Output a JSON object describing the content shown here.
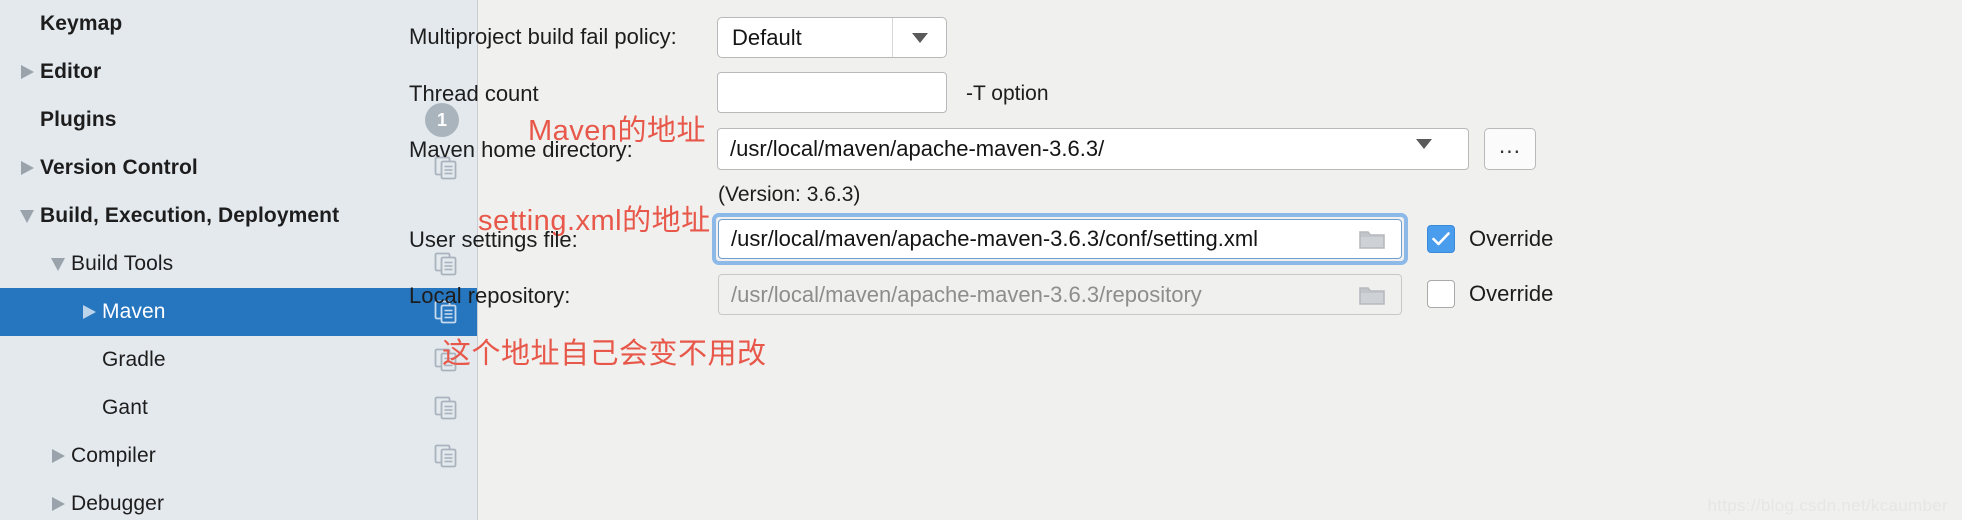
{
  "sidebar": {
    "items": [
      {
        "label": "Keymap",
        "indent": 0,
        "twisty": "none",
        "bold": true,
        "selected": false,
        "badge": null,
        "copy_icon": false
      },
      {
        "label": "Editor",
        "indent": 0,
        "twisty": "collapsed",
        "bold": true,
        "selected": false,
        "badge": null,
        "copy_icon": false
      },
      {
        "label": "Plugins",
        "indent": 0,
        "twisty": "none",
        "bold": true,
        "selected": false,
        "badge": "1",
        "copy_icon": false
      },
      {
        "label": "Version Control",
        "indent": 0,
        "twisty": "collapsed",
        "bold": true,
        "selected": false,
        "badge": null,
        "copy_icon": true
      },
      {
        "label": "Build, Execution, Deployment",
        "indent": 0,
        "twisty": "expanded",
        "bold": true,
        "selected": false,
        "badge": null,
        "copy_icon": false
      },
      {
        "label": "Build Tools",
        "indent": 1,
        "twisty": "expanded",
        "bold": false,
        "selected": false,
        "badge": null,
        "copy_icon": true
      },
      {
        "label": "Maven",
        "indent": 2,
        "twisty": "collapsed",
        "bold": false,
        "selected": true,
        "badge": null,
        "copy_icon": true
      },
      {
        "label": "Gradle",
        "indent": 2,
        "twisty": "none",
        "bold": false,
        "selected": false,
        "badge": null,
        "copy_icon": true
      },
      {
        "label": "Gant",
        "indent": 2,
        "twisty": "none",
        "bold": false,
        "selected": false,
        "badge": null,
        "copy_icon": true
      },
      {
        "label": "Compiler",
        "indent": 1,
        "twisty": "collapsed",
        "bold": false,
        "selected": false,
        "badge": null,
        "copy_icon": true
      },
      {
        "label": "Debugger",
        "indent": 1,
        "twisty": "collapsed",
        "bold": false,
        "selected": false,
        "badge": null,
        "copy_icon": false
      }
    ]
  },
  "main": {
    "fail_policy": {
      "label": "Multiproject build fail policy:",
      "value": "Default"
    },
    "thread_count": {
      "label": "Thread count",
      "value": "",
      "hint": "-T option"
    },
    "maven_home": {
      "label": "Maven home directory:",
      "value": "/usr/local/maven/apache-maven-3.6.3/",
      "browse_label": "...",
      "version_text": "(Version: 3.6.3)"
    },
    "user_settings": {
      "label": "User settings file:",
      "value": "/usr/local/maven/apache-maven-3.6.3/conf/setting.xml",
      "override_label": "Override",
      "override_checked": true
    },
    "local_repository": {
      "label": "Local repository:",
      "value": "/usr/local/maven/apache-maven-3.6.3/repository",
      "override_label": "Override",
      "override_checked": false
    }
  },
  "annotations": {
    "maven_home_note": "Maven的地址",
    "settings_note": "setting.xml的地址",
    "repository_note": "这个地址自己会变不用改"
  },
  "watermark": "https://blog.csdn.net/kcaumber",
  "colors": {
    "selection": "#2675bf",
    "annotation_red": "#e8584a",
    "checkbox_on": "#4a9cec",
    "sidebar_bg": "#e4e9ee",
    "main_bg": "#f0f0ef"
  }
}
